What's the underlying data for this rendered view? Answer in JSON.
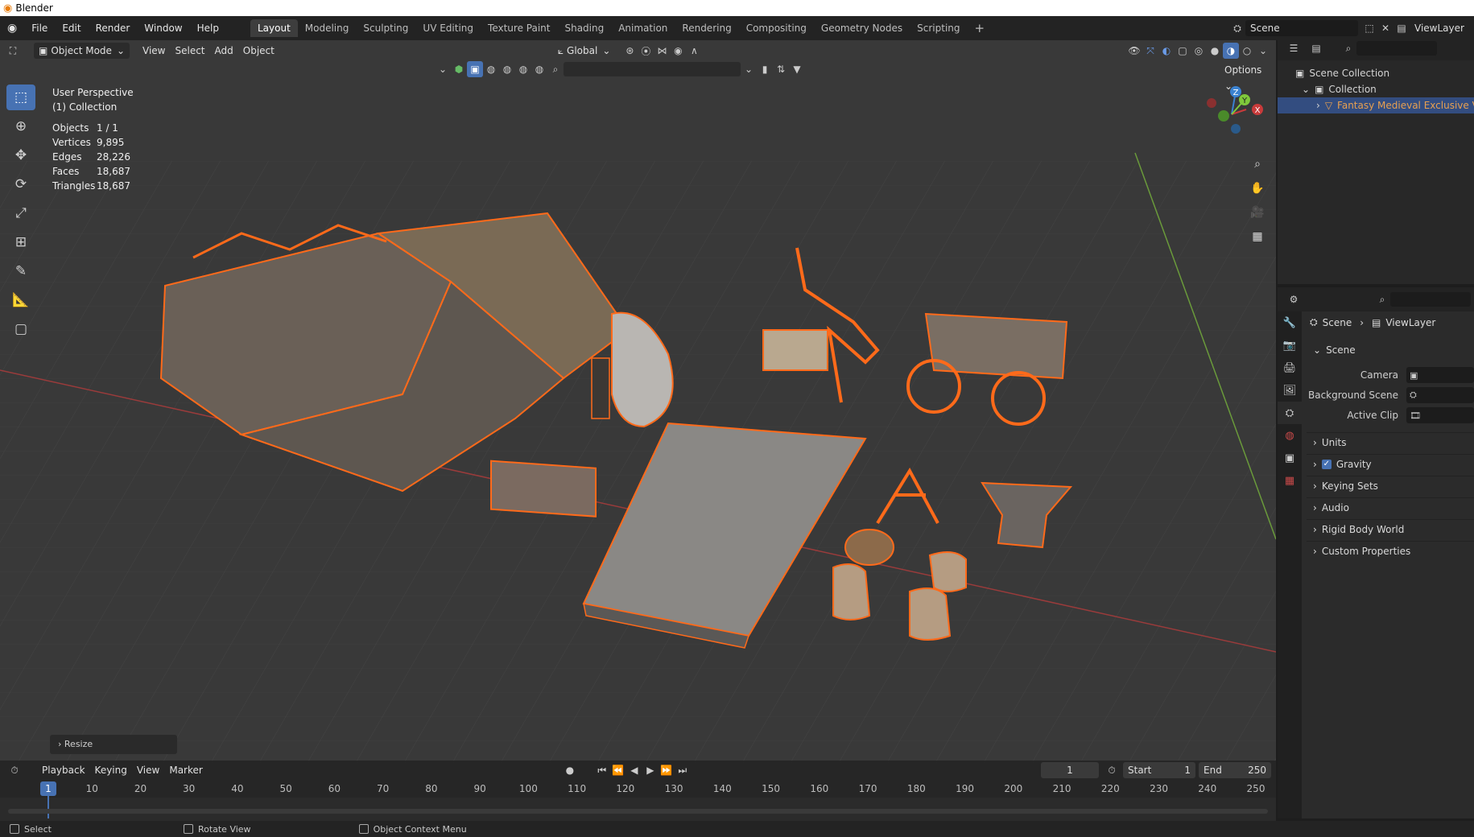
{
  "window": {
    "title": "Blender"
  },
  "menu": [
    "File",
    "Edit",
    "Render",
    "Window",
    "Help"
  ],
  "workspaces": [
    "Layout",
    "Modeling",
    "Sculpting",
    "UV Editing",
    "Texture Paint",
    "Shading",
    "Animation",
    "Rendering",
    "Compositing",
    "Geometry Nodes",
    "Scripting"
  ],
  "active_workspace": "Layout",
  "scene_selector": {
    "scene": "Scene",
    "view_layer": "ViewLayer"
  },
  "viewport_header": {
    "mode": "Object Mode",
    "menus": [
      "View",
      "Select",
      "Add",
      "Object"
    ],
    "transform_orientation": "Global",
    "options_label": "Options"
  },
  "viewport_overlay": {
    "perspective": "User Perspective",
    "collection": "(1) Collection",
    "stats": [
      {
        "label": "Objects",
        "value": "1 / 1"
      },
      {
        "label": "Vertices",
        "value": "9,895"
      },
      {
        "label": "Edges",
        "value": "28,226"
      },
      {
        "label": "Faces",
        "value": "18,687"
      },
      {
        "label": "Triangles",
        "value": "18,687"
      }
    ]
  },
  "gizmo_axes": {
    "x": "X",
    "y": "Y",
    "z": "Z"
  },
  "resize_panel": {
    "label": "Resize"
  },
  "outliner": {
    "root": "Scene Collection",
    "collection": "Collection",
    "object": "Fantasy Medieval Exclusive Villa"
  },
  "properties": {
    "breadcrumb_scene": "Scene",
    "breadcrumb_view_layer": "ViewLayer",
    "section": "Scene",
    "fields": [
      {
        "label": "Camera"
      },
      {
        "label": "Background Scene"
      },
      {
        "label": "Active Clip"
      }
    ],
    "subpanels": [
      "Units",
      "Gravity",
      "Keying Sets",
      "Audio",
      "Rigid Body World",
      "Custom Properties"
    ],
    "gravity_checked": true
  },
  "timeline": {
    "menus": [
      "Playback",
      "Keying",
      "View",
      "Marker"
    ],
    "current_frame": "1",
    "start_label": "Start",
    "start": "1",
    "end_label": "End",
    "end": "250",
    "ticks": [
      "1",
      "10",
      "20",
      "30",
      "40",
      "50",
      "60",
      "70",
      "80",
      "90",
      "100",
      "110",
      "120",
      "130",
      "140",
      "150",
      "160",
      "170",
      "180",
      "190",
      "200",
      "210",
      "220",
      "230",
      "240",
      "250"
    ]
  },
  "statusbar": [
    "Select",
    "Rotate View",
    "Object Context Menu"
  ],
  "colors": {
    "accent": "#4772b3",
    "selection_outline": "#ff6a1a",
    "x_axis": "#c93b3b",
    "y_axis": "#7fc93b"
  }
}
